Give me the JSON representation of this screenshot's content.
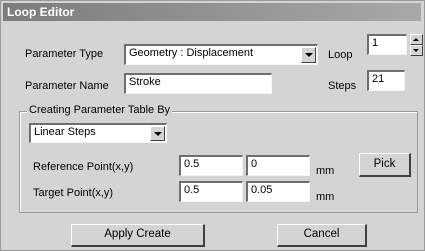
{
  "window": {
    "title": "Loop Editor"
  },
  "param": {
    "type_label": "Parameter Type",
    "type_value": "Geometry : Displacement",
    "name_label": "Parameter Name",
    "name_value": "Stroke"
  },
  "loop": {
    "label": "Loop",
    "value": "1"
  },
  "steps": {
    "label": "Steps",
    "value": "21"
  },
  "group": {
    "title": "Creating Parameter Table By",
    "method_value": "Linear Steps",
    "ref_label": "Reference Point(x,y)",
    "ref_x": "0.5",
    "ref_y": "0",
    "ref_unit": "mm",
    "target_label": "Target Point(x,y)",
    "target_x": "0.5",
    "target_y": "0.05",
    "target_unit": "mm",
    "pick_label": "Pick"
  },
  "buttons": {
    "apply": "Apply Create",
    "cancel": "Cancel"
  }
}
